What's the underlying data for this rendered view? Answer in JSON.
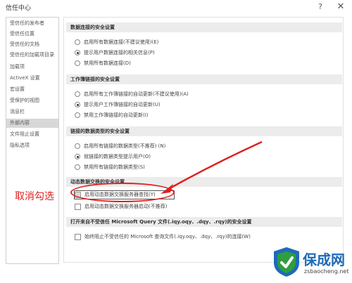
{
  "window": {
    "title": "信任中心",
    "help_glyph": "?",
    "close_glyph": "✕"
  },
  "nav": {
    "items": [
      {
        "label": "受信任的发布者"
      },
      {
        "label": "受信任位置"
      },
      {
        "label": "受信任的文档"
      },
      {
        "label": "受信任的加载项目录"
      },
      {
        "label": "加载项"
      },
      {
        "label": "ActiveX 设置"
      },
      {
        "label": "宏设置"
      },
      {
        "label": "受保护的视图"
      },
      {
        "label": "消息栏"
      },
      {
        "label": "外部内容",
        "selected": true
      },
      {
        "label": "文件阻止设置"
      },
      {
        "label": "隐私选项"
      }
    ]
  },
  "sections": {
    "data_conn": {
      "header": "数据连接的安全设置",
      "options": [
        {
          "label": "启用所有数据连接(不建议使用)(E)",
          "selected": false
        },
        {
          "label": "提示用户数据连接的相关信息(P)",
          "selected": true
        },
        {
          "label": "禁用所有数据连接(D)",
          "selected": false
        }
      ]
    },
    "workbook_links": {
      "header": "工作簿链接的安全设置",
      "options": [
        {
          "label": "启用所有工作簿链接的自动更新(不建议使用)(A)",
          "selected": false
        },
        {
          "label": "提示用户工作簿链接的自动更新(U)",
          "selected": true
        },
        {
          "label": "禁用工作簿链接的自动更新(I)",
          "selected": false
        }
      ]
    },
    "linked_types": {
      "header": "链接的数据类型的安全设置",
      "options": [
        {
          "label": "启用所有链接的数据类型(不推荐) (N)",
          "selected": false
        },
        {
          "label": "就链接的数据类型提示用户(O)",
          "selected": true
        },
        {
          "label": "禁用所有链接的数据类型(S)",
          "selected": false
        }
      ]
    },
    "dde": {
      "header": "动态数据交换的安全设置",
      "options": [
        {
          "label": "启用动态数据交换服务器查找(Y)",
          "checked": false,
          "focused": true
        },
        {
          "label": "启用动态数据交换服务器启动(不推荐)",
          "checked": false
        }
      ]
    },
    "mq": {
      "header": "打开来自不受信任 Microsoft Query 文件(.iqy.oqy、.dqy、.rqy)的安全设置",
      "options": [
        {
          "label": "始终阻止不受信任的 Microsoft 查询文件(.iqy.oqy、.dqy、.rqy)的连接(W)",
          "checked": false
        }
      ]
    }
  },
  "annotation": {
    "text": "取消勾选",
    "color": "#e02020"
  },
  "watermark": {
    "brand": "保成网",
    "url": "zsbaocheng.net",
    "brand_color": "#1e6bb8"
  }
}
